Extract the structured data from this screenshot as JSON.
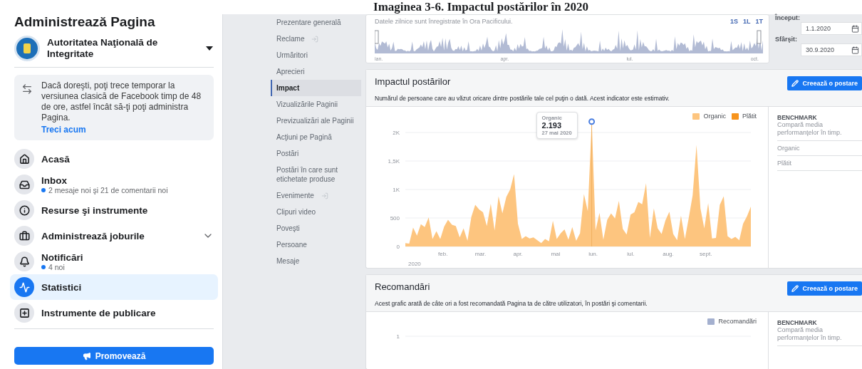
{
  "caption": "Imaginea 3-6. Impactul postărilor în 2020",
  "sidebar": {
    "title": "Administrează Pagina",
    "page_name": "Autoritatea Naţională de Integritate",
    "notice": {
      "text": "Dacă doreşti, poţi trece temporar la versiunea clasică de Facebook timp de 48 de ore, astfel încât să-ţi poţi administra Pagina.",
      "link": "Treci acum"
    },
    "items": [
      {
        "label": "Acasă",
        "selected": false
      },
      {
        "label": "Inbox",
        "sub": "2 mesaje noi şi 21 de comentarii noi",
        "selected": false
      },
      {
        "label": "Resurse şi instrumente",
        "selected": false
      },
      {
        "label": "Administrează joburile",
        "selected": false,
        "expandable": true
      },
      {
        "label": "Notificări",
        "sub": "4 noi",
        "selected": false
      },
      {
        "label": "Statistici",
        "selected": true
      },
      {
        "label": "Instrumente de publicare",
        "selected": false
      }
    ],
    "promote_button": "Promovează"
  },
  "insights_nav": [
    {
      "label": "Prezentare generală",
      "selected": false
    },
    {
      "label": "Reclame",
      "selected": false,
      "external": true
    },
    {
      "label": "Urmăritori",
      "selected": false
    },
    {
      "label": "Aprecieri",
      "selected": false
    },
    {
      "label": "Impact",
      "selected": true
    },
    {
      "label": "Vizualizările Paginii",
      "selected": false
    },
    {
      "label": "Previzualizări ale Paginii",
      "selected": false
    },
    {
      "label": "Acţiuni pe Pagină",
      "selected": false
    },
    {
      "label": "Postări",
      "selected": false
    },
    {
      "label": "Postări în care sunt etichetate produse",
      "selected": false
    },
    {
      "label": "Evenimente",
      "selected": false,
      "external": true
    },
    {
      "label": "Clipuri video",
      "selected": false
    },
    {
      "label": "Poveşti",
      "selected": false
    },
    {
      "label": "Persoane",
      "selected": false
    },
    {
      "label": "Mesaje",
      "selected": false
    }
  ],
  "timeline": {
    "note": "Datele zilnice sunt înregistrate în Ora Pacificului.",
    "ranges": [
      "1S",
      "1L",
      "1T"
    ],
    "months": [
      "ian.",
      "apr.",
      "iul.",
      "oct."
    ]
  },
  "date_range": {
    "start_label": "Început:",
    "start": "1.1.2020",
    "end_label": "Sfârşit:",
    "end": "30.9.2020"
  },
  "post_reach": {
    "title": "Impactul postărilor",
    "description": "Numărul de persoane care au văzut oricare dintre postările tale cel puţin o dată. Acest indicator este estimativ.",
    "create_button": "Creează o postare",
    "legend": [
      {
        "label": "Organic",
        "color": "#fdc57f"
      },
      {
        "label": "Plătit",
        "color": "#f7941d"
      }
    ],
    "year_label": "2020",
    "x_labels": [
      "feb.",
      "mar.",
      "apr.",
      "mai",
      "iun.",
      "iul.",
      "aug.",
      "sept."
    ],
    "tooltip": {
      "value": "2.193",
      "date": "27 mai 2020"
    },
    "chart_data": {
      "type": "area",
      "ylim": [
        0,
        2200
      ],
      "grid": true,
      "yticks": [
        {
          "value": 0,
          "label": "0"
        },
        {
          "value": 500,
          "label": "500"
        },
        {
          "value": 1000,
          "label": "1K"
        },
        {
          "value": 1500,
          "label": "1,5K"
        },
        {
          "value": 2000,
          "label": "2K"
        }
      ],
      "series": [
        {
          "name": "Organic",
          "color": "#fdc57f",
          "values": [
            60,
            50,
            330,
            190,
            390,
            340,
            510,
            130,
            270,
            130,
            350,
            470,
            380,
            360,
            160,
            320,
            100,
            520,
            730,
            650,
            600,
            360,
            750,
            280,
            880,
            580,
            870,
            1000,
            1270,
            400,
            130,
            180,
            140,
            160,
            110,
            60,
            130,
            90,
            450,
            130,
            230,
            300,
            120,
            340,
            100,
            230,
            920,
            620,
            2190,
            280,
            590,
            120,
            470,
            580,
            490,
            800,
            310,
            210,
            560,
            600,
            780,
            740,
            1110,
            150,
            670,
            320,
            220,
            460,
            610,
            220,
            110,
            540,
            130,
            500,
            900,
            1780,
            670,
            320,
            760,
            140,
            150,
            730,
            880,
            180,
            130,
            170,
            110,
            400,
            530,
            700
          ]
        }
      ]
    },
    "benchmark": {
      "title": "BENCHMARK",
      "subtitle": "Compară media performanţelor în timp.",
      "rows": [
        "Organic",
        "Plătit"
      ]
    }
  },
  "recommendations": {
    "title": "Recomandări",
    "description": "Acest grafic arată de câte ori a fost recomandată Pagina ta de către utilizatori, în postări şi comentarii.",
    "create_button": "Creează o postare",
    "legend": [
      {
        "label": "Recomandări",
        "color": "#a4b0cf"
      }
    ],
    "y_tick": "1",
    "benchmark": {
      "title": "BENCHMARK",
      "subtitle": "Compară media performanţelor în timp."
    }
  }
}
